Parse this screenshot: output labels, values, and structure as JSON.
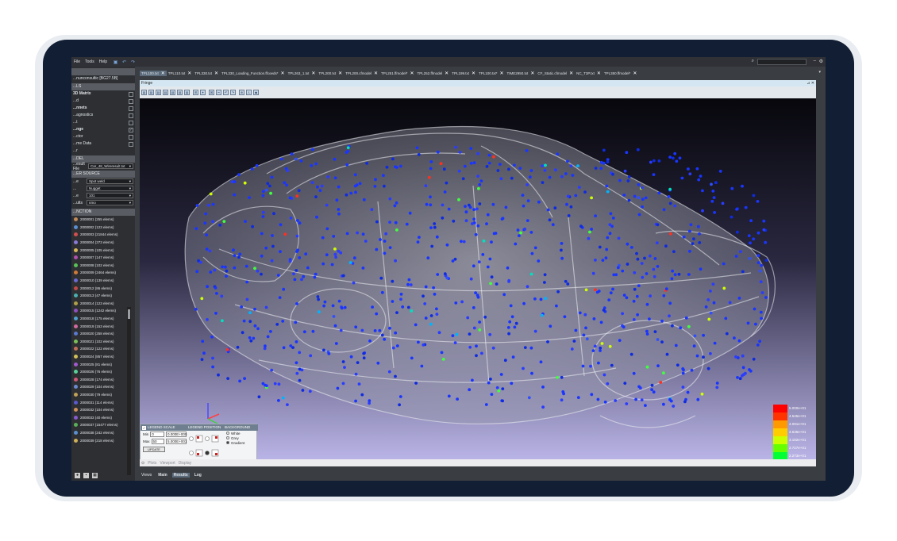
{
  "menu": [
    "File",
    "Tools",
    "Help"
  ],
  "sidebar": {
    "title": "...nunconsultic [BG27.5B]",
    "section1": "...LS",
    "items": [
      {
        "label": "3D Matrix",
        "bold": true,
        "checked": false
      },
      {
        "label": "...d",
        "bold": false,
        "checked": false
      },
      {
        "label": "...nnets",
        "bold": true,
        "checked": false
      },
      {
        "label": "...agnostics",
        "bold": false,
        "checked": false
      },
      {
        "label": "...t",
        "bold": false,
        "checked": false
      },
      {
        "label": "...nge",
        "bold": true,
        "checked": true
      },
      {
        "label": "...ctor",
        "bold": false,
        "checked": false
      },
      {
        "label": "...me Data",
        "bold": false,
        "checked": false
      }
    ],
    "section2": "...r",
    "model_band": "...DEL",
    "result_file_label": "...esult File",
    "result_file_value": "Car_48_Wireresult.txt",
    "source_band": "...ER SOURCE",
    "selects": [
      {
        "label": "...e",
        "value": "Spot weld"
      },
      {
        "label": "...",
        "value": "Nugget"
      },
      {
        "label": "...e",
        "value": "101"
      },
      {
        "label": "...ults",
        "value": "nmo"
      }
    ],
    "function_band": "...NCTION",
    "components": [
      {
        "label": "2000001 (255 elems)",
        "color": "#c08a5a"
      },
      {
        "label": "2000002 (123 elems)",
        "color": "#5b8fd1"
      },
      {
        "label": "2000003 (21844 elems)",
        "color": "#d05050"
      },
      {
        "label": "2000004 (373 elems)",
        "color": "#8a7ad8"
      },
      {
        "label": "2000005 (105 elems)",
        "color": "#d8b65a"
      },
      {
        "label": "2000007 (147 elems)",
        "color": "#b050b0"
      },
      {
        "label": "2000008 (102 elems)",
        "color": "#5ac05a"
      },
      {
        "label": "2000009 (2464 elems)",
        "color": "#d07a3a"
      },
      {
        "label": "2000010 (139 elems)",
        "color": "#6a6ad8"
      },
      {
        "label": "2000012 (86 elems)",
        "color": "#c04a4a"
      },
      {
        "label": "2000013 (47 elems)",
        "color": "#4ab0b0"
      },
      {
        "label": "2000014 (123 elems)",
        "color": "#b0a04a"
      },
      {
        "label": "2000015 (1242 elems)",
        "color": "#9050c0"
      },
      {
        "label": "2000018 (175 elems)",
        "color": "#50a0d0"
      },
      {
        "label": "2000019 (153 elems)",
        "color": "#d06aa0"
      },
      {
        "label": "2000020 (258 elems)",
        "color": "#5a7ad0"
      },
      {
        "label": "2000021 (102 elems)",
        "color": "#7ac05a"
      },
      {
        "label": "2000022 (122 elems)",
        "color": "#c0705a"
      },
      {
        "label": "2000024 (857 elems)",
        "color": "#d0c05a"
      },
      {
        "label": "2000025 (81 elems)",
        "color": "#a05ad0"
      },
      {
        "label": "2000026 (76 elems)",
        "color": "#5ad09a"
      },
      {
        "label": "2000028 (174 elems)",
        "color": "#d05a7a"
      },
      {
        "label": "2000029 (104 elems)",
        "color": "#6a8ad0"
      },
      {
        "label": "2000030 (79 elems)",
        "color": "#c0a05a"
      },
      {
        "label": "2000031 (114 elems)",
        "color": "#5a5ad0"
      },
      {
        "label": "2000032 (104 elems)",
        "color": "#d0905a"
      },
      {
        "label": "2000033 (40 elems)",
        "color": "#8a5ad0"
      },
      {
        "label": "2000037 (15477 elems)",
        "color": "#5ab05a"
      },
      {
        "label": "2000038 (242 elems)",
        "color": "#5a90d0"
      },
      {
        "label": "2000039 (218 elems)",
        "color": "#d0b05a"
      }
    ]
  },
  "tabs": [
    {
      "label": "TPL100.txt",
      "active": true
    },
    {
      "label": "TPL110.txt",
      "active": false
    },
    {
      "label": "TPL330.txt",
      "active": false
    },
    {
      "label": "TPL330_Loading_Function.ffcoeds*",
      "active": false
    },
    {
      "label": "TPL263_1.txt",
      "active": false
    },
    {
      "label": "TPL200.txt",
      "active": false
    },
    {
      "label": "TPL200.cfmodel",
      "active": false
    },
    {
      "label": "TPL251.ffmodel*",
      "active": false
    },
    {
      "label": "TPL252.ffmodel",
      "active": false
    },
    {
      "label": "TPL199.txt",
      "active": false
    },
    {
      "label": "TPL100.txt*",
      "active": false
    },
    {
      "label": "TIME2950.txt",
      "active": false
    },
    {
      "label": "CF_Static.cfmodel",
      "active": false
    },
    {
      "label": "NC_T3P.txt",
      "active": false
    },
    {
      "label": "TPL350.ffmodel*",
      "active": false
    }
  ],
  "window_title": "Fringe",
  "legend": {
    "bands": [
      {
        "label": "5.000e+01",
        "color": "#ff0000"
      },
      {
        "label": "4.545e+01",
        "color": "#ff3300"
      },
      {
        "label": "4.091e+01",
        "color": "#ff9900"
      },
      {
        "label": "3.636e+01",
        "color": "#ffcc00"
      },
      {
        "label": "3.182e+01",
        "color": "#ccff00"
      },
      {
        "label": "2.727e+01",
        "color": "#66ff00"
      },
      {
        "label": "2.273e+01",
        "color": "#00ff33"
      },
      {
        "label": "1.818e+01",
        "color": "#00ffcc"
      },
      {
        "label": "1.364e+01",
        "color": "#00ccff"
      },
      {
        "label": "9.091e+00",
        "color": "#0088ff"
      },
      {
        "label": "4.545e+00",
        "color": "#0044ff"
      },
      {
        "label": "0.000e+00",
        "color": "#0000ff"
      }
    ]
  },
  "legend_panel": {
    "scale_title": "LEGEND SCALE",
    "min_label": "Min",
    "min_value": "0",
    "min_sci": "0.000E+000",
    "max_label": "Max",
    "max_value": "50",
    "max_sci": "5.000E+001",
    "update_label": "UPDATE",
    "position_title": "LEGEND POSITION",
    "background_title": "BACKGROUND",
    "bg_options": [
      {
        "label": "White",
        "on": false
      },
      {
        "label": "Grey",
        "on": false
      },
      {
        "label": "Gradient",
        "on": true
      }
    ]
  },
  "viewport_tabs": [
    "Plots",
    "Viewport",
    "Display"
  ],
  "bottom_tabs": [
    {
      "label": "Views",
      "bold": false,
      "active": false
    },
    {
      "label": "Main",
      "bold": true,
      "active": false
    },
    {
      "label": "Results",
      "bold": true,
      "active": true
    },
    {
      "label": "Log",
      "bold": true,
      "active": false
    }
  ]
}
